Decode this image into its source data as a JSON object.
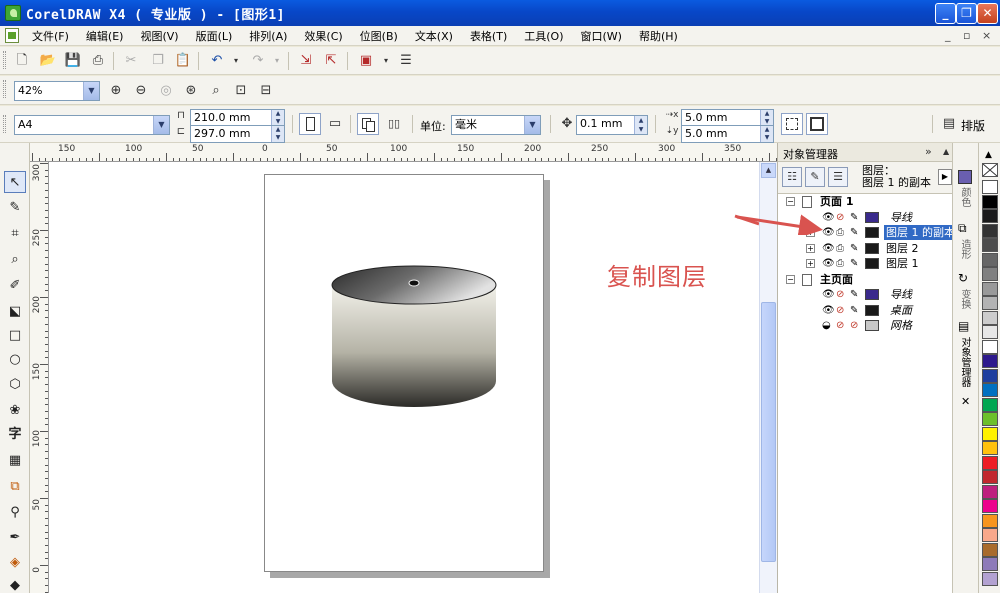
{
  "window": {
    "title": "CorelDRAW X4 ( 专业版 ) - [图形1]",
    "minimize": "_",
    "restore": "❐",
    "close": "✕"
  },
  "menu": {
    "items": [
      "文件(F)",
      "编辑(E)",
      "视图(V)",
      "版面(L)",
      "排列(A)",
      "效果(C)",
      "位图(B)",
      "文本(X)",
      "表格(T)",
      "工具(O)",
      "窗口(W)",
      "帮助(H)"
    ],
    "mdi_minimize": "_",
    "mdi_restore": "▫",
    "mdi_close": "×"
  },
  "zoom": {
    "value": "42%"
  },
  "property_bar": {
    "paper_size": "A4",
    "width": "210.0 mm",
    "height": "297.0 mm",
    "units_label": "单位:",
    "units_value": "毫米",
    "nudge": "0.1 mm",
    "dup_x": "5.0 mm",
    "dup_y": "5.0 mm",
    "arrange_label": "排版"
  },
  "ruler": {
    "h_labels": [
      "150",
      "100",
      "50",
      "0",
      "50",
      "100",
      "150",
      "200",
      "250",
      "300",
      "350"
    ],
    "v_labels": [
      "300",
      "250",
      "200",
      "150",
      "100",
      "50",
      "0"
    ]
  },
  "canvas": {
    "annotation": "复制图层"
  },
  "object_manager": {
    "title": "对象管理器",
    "info_line1": "图层：",
    "info_line2": "图层 1  的副本",
    "rows": [
      {
        "kind": "page",
        "label": "页面 1"
      },
      {
        "kind": "layer",
        "label": "导线",
        "swatch": "#3a2a8c",
        "italic": true
      },
      {
        "kind": "layer",
        "label": "图层 1  的副本",
        "swatch": "#1a1a1a",
        "selected": true
      },
      {
        "kind": "layer",
        "label": "图层 2",
        "swatch": "#1a1a1a"
      },
      {
        "kind": "layer",
        "label": "图层 1",
        "swatch": "#1a1a1a"
      },
      {
        "kind": "page",
        "label": "主页面"
      },
      {
        "kind": "layer",
        "label": "导线",
        "swatch": "#3a2a8c",
        "italic": true
      },
      {
        "kind": "layer",
        "label": "桌面",
        "swatch": "#1a1a1a",
        "italic": true
      },
      {
        "kind": "layer",
        "label": "网格",
        "swatch": "#c8c8c8",
        "italic": true
      }
    ]
  },
  "side_tabs": [
    "颜色",
    "造形",
    "变换",
    "对象管理器"
  ],
  "palette": [
    "#ffffff",
    "#000000",
    "#1a1a1a",
    "#333333",
    "#4d4d4d",
    "#666666",
    "#808080",
    "#999999",
    "#b3b3b3",
    "#cccccc",
    "#e6e6e6",
    "#ffffff",
    "#2e1a8c",
    "#1f3f9f",
    "#0070c0",
    "#00a651",
    "#6cbf2a",
    "#fff200",
    "#ffc20e",
    "#ed1c24",
    "#c1272d",
    "#be1e7e",
    "#ec008c",
    "#f7941d",
    "#f9a88a",
    "#a86b2b",
    "#8d7ab8",
    "#b3a2d1"
  ]
}
